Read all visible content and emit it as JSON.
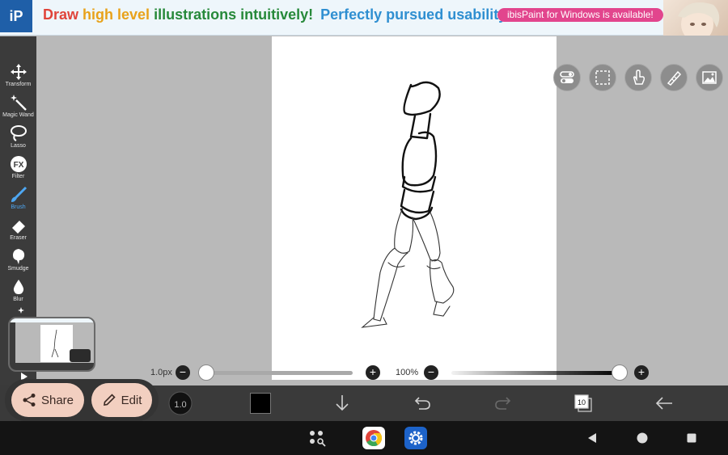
{
  "ad": {
    "headline_part1": "Draw",
    "headline_part2": "high level",
    "headline_part3": "illustrations",
    "headline_part4": "intuitively!",
    "headline_part5": "Perfectly pursued usability!",
    "badge": "ibisPaint for Windows is available!",
    "logo_text": "iP"
  },
  "toolbar": {
    "tools": [
      {
        "label": "Transform",
        "icon": "move-arrows-icon"
      },
      {
        "label": "Magic Wand",
        "icon": "magic-wand-icon"
      },
      {
        "label": "Lasso",
        "icon": "lasso-icon"
      },
      {
        "label": "Filter",
        "icon": "fx-icon"
      },
      {
        "label": "Brush",
        "icon": "brush-icon",
        "active": true
      },
      {
        "label": "Eraser",
        "icon": "eraser-icon"
      },
      {
        "label": "Smudge",
        "icon": "smudge-icon"
      },
      {
        "label": "Blur",
        "icon": "blur-drop-icon"
      }
    ],
    "filter_icon_text": "FX"
  },
  "sliders": {
    "brush_size_label": "1.0px",
    "opacity_label": "100%",
    "brush_size_value": 0.0,
    "opacity_value": 1.0
  },
  "bottombar": {
    "brush_size_indicator": "1.0",
    "layer_count": "10",
    "current_color": "#000000"
  },
  "float_panel": {
    "share_label": "Share",
    "edit_label": "Edit"
  },
  "colors": {
    "accent_active": "#4ea7f2",
    "pill_bg": "#f2cfc0",
    "toolbar_bg": "#3b3b3b"
  }
}
